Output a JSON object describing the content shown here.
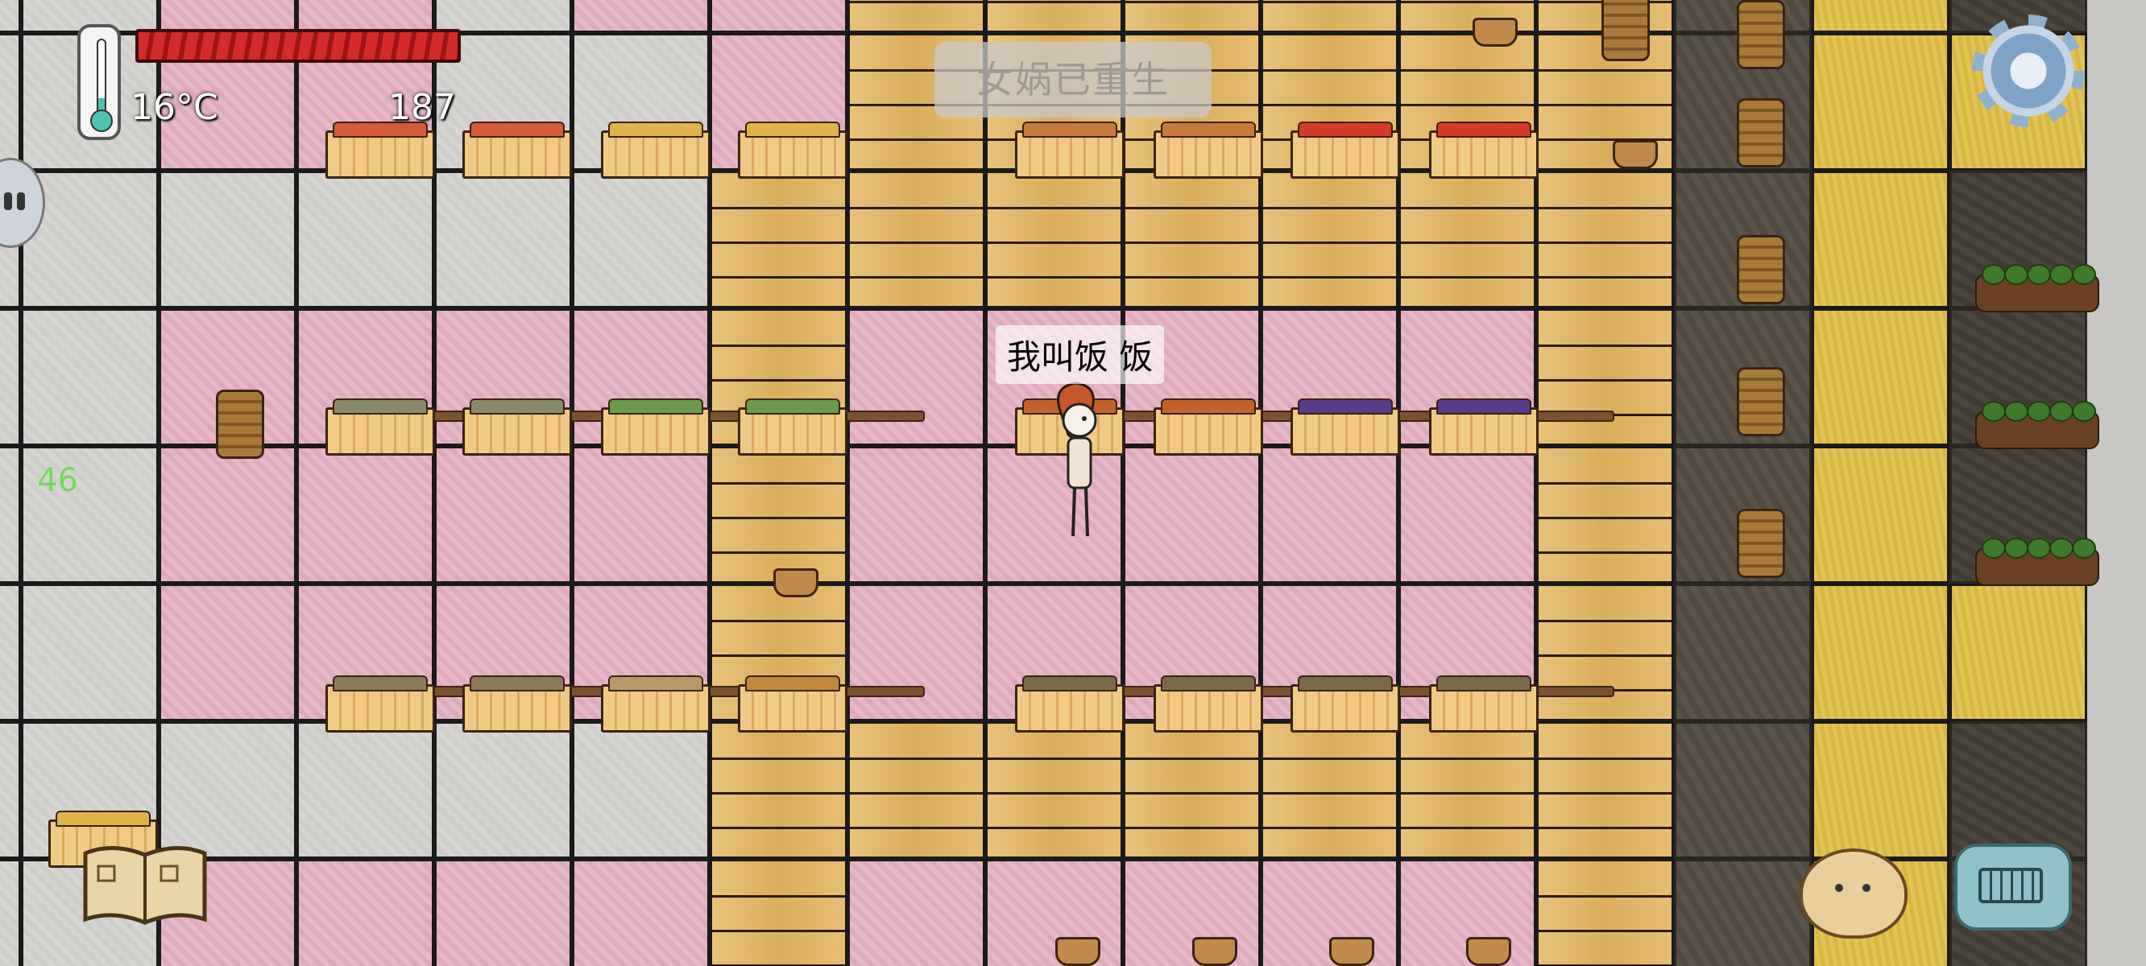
{
  "hud": {
    "temperature": "16°C",
    "age": "187",
    "fps": "46",
    "food_bar_fill": 1.0
  },
  "notice": {
    "text": "女娲已重生"
  },
  "player": {
    "speech": "我叫饭 饭"
  },
  "buttons": {
    "settings_icon": "gear-icon",
    "book_icon": "recipe-book-icon",
    "emote_icon": "potato-face-icon",
    "keyboard_icon": "keyboard-icon"
  },
  "colors": {
    "pink_floor": "#e6b7c7",
    "gray_floor": "#d6d4d1",
    "wood_floor": "#e3b86c",
    "food_bar": "#d42a2a",
    "fps_text": "#6fdc55"
  }
}
